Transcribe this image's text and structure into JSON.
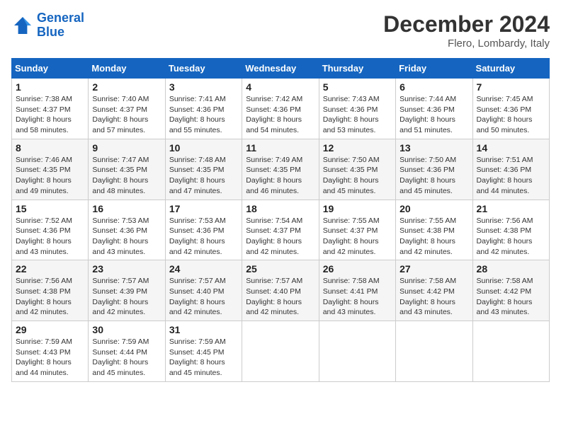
{
  "header": {
    "logo_line1": "General",
    "logo_line2": "Blue",
    "month_year": "December 2024",
    "location": "Flero, Lombardy, Italy"
  },
  "weekdays": [
    "Sunday",
    "Monday",
    "Tuesday",
    "Wednesday",
    "Thursday",
    "Friday",
    "Saturday"
  ],
  "weeks": [
    [
      {
        "day": "1",
        "sunrise": "7:38 AM",
        "sunset": "4:37 PM",
        "daylight": "8 hours and 58 minutes."
      },
      {
        "day": "2",
        "sunrise": "7:40 AM",
        "sunset": "4:37 PM",
        "daylight": "8 hours and 57 minutes."
      },
      {
        "day": "3",
        "sunrise": "7:41 AM",
        "sunset": "4:36 PM",
        "daylight": "8 hours and 55 minutes."
      },
      {
        "day": "4",
        "sunrise": "7:42 AM",
        "sunset": "4:36 PM",
        "daylight": "8 hours and 54 minutes."
      },
      {
        "day": "5",
        "sunrise": "7:43 AM",
        "sunset": "4:36 PM",
        "daylight": "8 hours and 53 minutes."
      },
      {
        "day": "6",
        "sunrise": "7:44 AM",
        "sunset": "4:36 PM",
        "daylight": "8 hours and 51 minutes."
      },
      {
        "day": "7",
        "sunrise": "7:45 AM",
        "sunset": "4:36 PM",
        "daylight": "8 hours and 50 minutes."
      }
    ],
    [
      {
        "day": "8",
        "sunrise": "7:46 AM",
        "sunset": "4:35 PM",
        "daylight": "8 hours and 49 minutes."
      },
      {
        "day": "9",
        "sunrise": "7:47 AM",
        "sunset": "4:35 PM",
        "daylight": "8 hours and 48 minutes."
      },
      {
        "day": "10",
        "sunrise": "7:48 AM",
        "sunset": "4:35 PM",
        "daylight": "8 hours and 47 minutes."
      },
      {
        "day": "11",
        "sunrise": "7:49 AM",
        "sunset": "4:35 PM",
        "daylight": "8 hours and 46 minutes."
      },
      {
        "day": "12",
        "sunrise": "7:50 AM",
        "sunset": "4:35 PM",
        "daylight": "8 hours and 45 minutes."
      },
      {
        "day": "13",
        "sunrise": "7:50 AM",
        "sunset": "4:36 PM",
        "daylight": "8 hours and 45 minutes."
      },
      {
        "day": "14",
        "sunrise": "7:51 AM",
        "sunset": "4:36 PM",
        "daylight": "8 hours and 44 minutes."
      }
    ],
    [
      {
        "day": "15",
        "sunrise": "7:52 AM",
        "sunset": "4:36 PM",
        "daylight": "8 hours and 43 minutes."
      },
      {
        "day": "16",
        "sunrise": "7:53 AM",
        "sunset": "4:36 PM",
        "daylight": "8 hours and 43 minutes."
      },
      {
        "day": "17",
        "sunrise": "7:53 AM",
        "sunset": "4:36 PM",
        "daylight": "8 hours and 42 minutes."
      },
      {
        "day": "18",
        "sunrise": "7:54 AM",
        "sunset": "4:37 PM",
        "daylight": "8 hours and 42 minutes."
      },
      {
        "day": "19",
        "sunrise": "7:55 AM",
        "sunset": "4:37 PM",
        "daylight": "8 hours and 42 minutes."
      },
      {
        "day": "20",
        "sunrise": "7:55 AM",
        "sunset": "4:38 PM",
        "daylight": "8 hours and 42 minutes."
      },
      {
        "day": "21",
        "sunrise": "7:56 AM",
        "sunset": "4:38 PM",
        "daylight": "8 hours and 42 minutes."
      }
    ],
    [
      {
        "day": "22",
        "sunrise": "7:56 AM",
        "sunset": "4:38 PM",
        "daylight": "8 hours and 42 minutes."
      },
      {
        "day": "23",
        "sunrise": "7:57 AM",
        "sunset": "4:39 PM",
        "daylight": "8 hours and 42 minutes."
      },
      {
        "day": "24",
        "sunrise": "7:57 AM",
        "sunset": "4:40 PM",
        "daylight": "8 hours and 42 minutes."
      },
      {
        "day": "25",
        "sunrise": "7:57 AM",
        "sunset": "4:40 PM",
        "daylight": "8 hours and 42 minutes."
      },
      {
        "day": "26",
        "sunrise": "7:58 AM",
        "sunset": "4:41 PM",
        "daylight": "8 hours and 43 minutes."
      },
      {
        "day": "27",
        "sunrise": "7:58 AM",
        "sunset": "4:42 PM",
        "daylight": "8 hours and 43 minutes."
      },
      {
        "day": "28",
        "sunrise": "7:58 AM",
        "sunset": "4:42 PM",
        "daylight": "8 hours and 43 minutes."
      }
    ],
    [
      {
        "day": "29",
        "sunrise": "7:59 AM",
        "sunset": "4:43 PM",
        "daylight": "8 hours and 44 minutes."
      },
      {
        "day": "30",
        "sunrise": "7:59 AM",
        "sunset": "4:44 PM",
        "daylight": "8 hours and 45 minutes."
      },
      {
        "day": "31",
        "sunrise": "7:59 AM",
        "sunset": "4:45 PM",
        "daylight": "8 hours and 45 minutes."
      },
      null,
      null,
      null,
      null
    ]
  ],
  "labels": {
    "sunrise": "Sunrise: ",
    "sunset": "Sunset: ",
    "daylight": "Daylight: "
  }
}
